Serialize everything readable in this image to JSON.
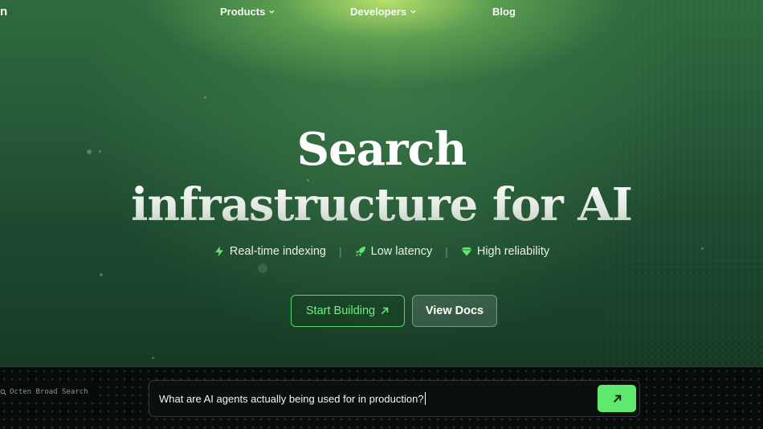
{
  "nav": {
    "logo_fragment": "n",
    "items": [
      {
        "label": "Products",
        "has_dropdown": true
      },
      {
        "label": "Developers",
        "has_dropdown": true
      },
      {
        "label": "Blog",
        "has_dropdown": false
      }
    ]
  },
  "hero": {
    "title_line1": "Search",
    "title_line2": "infrastructure for AI",
    "features": [
      {
        "label": "Real-time indexing",
        "icon": "lightning-bolt-icon"
      },
      {
        "label": "Low latency",
        "icon": "rocket-icon"
      },
      {
        "label": "High reliability",
        "icon": "diamond-icon"
      }
    ],
    "separator": "|",
    "primary_button": "Start Building",
    "secondary_button": "View Docs"
  },
  "search": {
    "label": "Octen Broad Search",
    "value": "What are AI agents actually being used for in production?"
  },
  "colors": {
    "accent_green": "#5ee86d",
    "hero_top": "#2f6a3e",
    "hero_bottom": "#173a27",
    "panel_bg": "#070b09"
  }
}
